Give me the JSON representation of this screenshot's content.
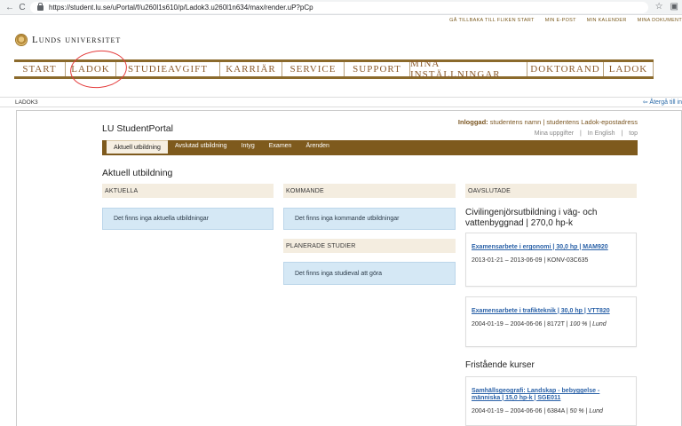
{
  "browser": {
    "back": "←",
    "reload": "C",
    "url": "https://student.lu.se/uPortal/f/u260l1s610/p/Ladok3.u260l1n634/max/render.uP?pCp",
    "star": "☆",
    "extension": "▣"
  },
  "util_links": [
    "Gå tillbaka till fliken start",
    "Min e-post",
    "Min kalender",
    "Mina dokument"
  ],
  "logo": {
    "name": "Lunds universitet"
  },
  "main_nav": [
    "START",
    "LADOK",
    "STUDIEAVGIFT",
    "KARRIÄR",
    "SERVICE",
    "SUPPORT",
    "MINA INSTÄLLNINGAR",
    "DOKTORAND",
    "LADOK"
  ],
  "portlet": {
    "title": "LADOK3",
    "back_link": "⇦ Återgå till in"
  },
  "app": {
    "title": "LU StudentPortal",
    "logged_in_label": "Inloggad:",
    "logged_in_name": " studentens namn",
    "email": "studentens Ladok-epostadress",
    "links": [
      "Mina uppgifter",
      "In English",
      "top"
    ]
  },
  "subnav": [
    "Aktuell utbildning",
    "Avslutad utbildning",
    "Intyg",
    "Examen",
    "Ärenden"
  ],
  "section_title": "Aktuell utbildning",
  "columns": {
    "aktuella": {
      "head": "AKTUELLA",
      "empty": "Det finns inga aktuella utbildningar"
    },
    "kommande": {
      "head": "KOMMANDE",
      "empty": "Det finns inga kommande utbildningar"
    },
    "planerade": {
      "head": "PLANERADE STUDIER",
      "empty": "Det finns inga studieval att göra"
    },
    "avslutade": {
      "head": "OAVSLUTADE"
    }
  },
  "programme": {
    "title": "Civilingenjörsutbildning i väg- och vattenbyggnad | 270,0 hp-k"
  },
  "courses": [
    {
      "link": "Examensarbete i ergonomi | 30,0 hp | MAM920",
      "meta": "2013-01-21 – 2013-06-09 | KONV-03C635",
      "pct": "",
      "place": ""
    },
    {
      "link": "Examensarbete i trafikteknik | 30,0 hp | VTT820",
      "meta": "2004-01-19 – 2004-06-06 | 8172T | ",
      "pct": "100 %",
      "place": "Lund"
    }
  ],
  "fristaende": {
    "title": "Fristående kurser",
    "courses": [
      {
        "link": "Samhällsgeografi: Landskap - bebyggelse - människa | 15,0 hp-k | SGE011",
        "meta": "2004-01-19 – 2004-06-06 | 6384A | ",
        "pct": "50 %",
        "place": "Lund"
      }
    ]
  }
}
